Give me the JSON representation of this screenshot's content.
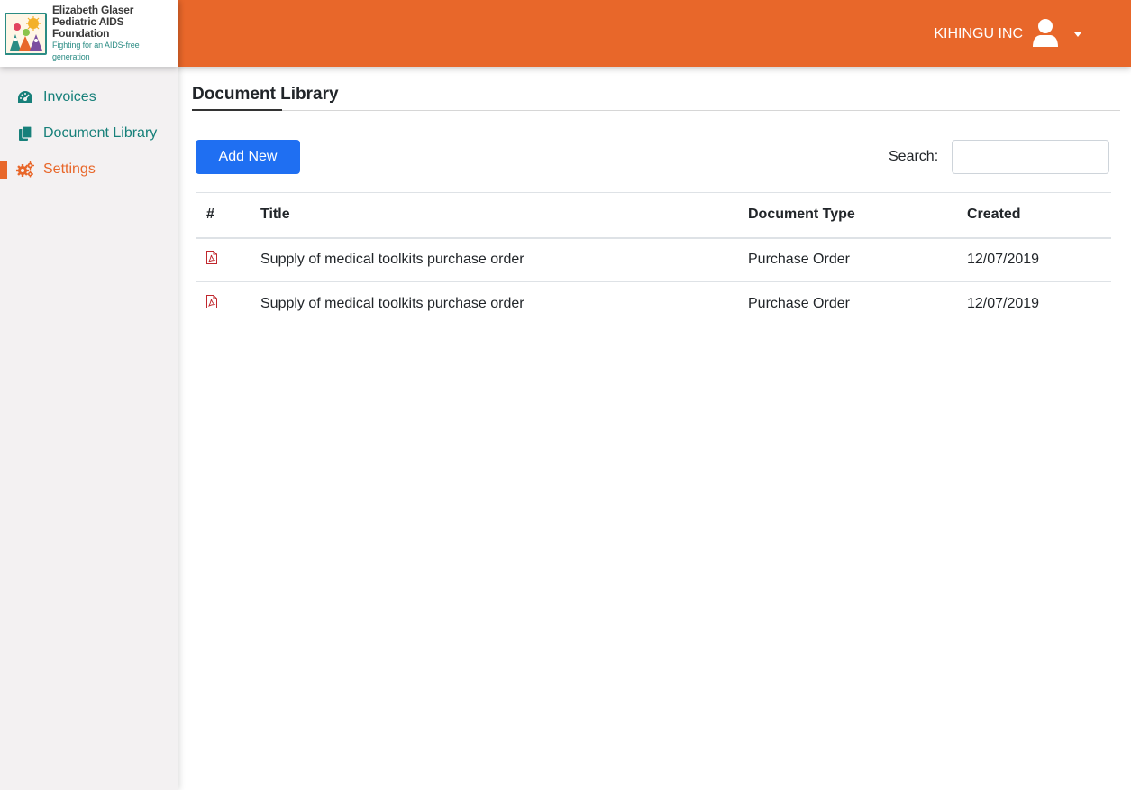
{
  "logo": {
    "line1": "Elizabeth Glaser",
    "line2": "Pediatric AIDS Foundation",
    "line3": "Fighting for an AIDS-free generation"
  },
  "sidebar": {
    "items": [
      {
        "label": "Invoices",
        "icon": "dashboard-icon",
        "active": false
      },
      {
        "label": "Document Library",
        "icon": "documents-icon",
        "active": false
      },
      {
        "label": "Settings",
        "icon": "cogs-icon",
        "active": true
      }
    ]
  },
  "header": {
    "user_name": "KIHINGU INC",
    "user_icon": "user-icon",
    "dropdown_icon": "caret-down-icon"
  },
  "page": {
    "title": "Document Library",
    "add_button": "Add New",
    "search_label": "Search:",
    "search_value": ""
  },
  "table": {
    "columns": [
      "#",
      "Title",
      "Document Type",
      "Created"
    ],
    "rows": [
      {
        "icon": "pdf-file-icon",
        "title": "Supply of medical toolkits purchase order",
        "type": "Purchase Order",
        "created": "12/07/2019"
      },
      {
        "icon": "pdf-file-icon",
        "title": "Supply of medical toolkits purchase order",
        "type": "Purchase Order",
        "created": "12/07/2019"
      }
    ]
  },
  "colors": {
    "brand_orange": "#e8672a",
    "nav_teal": "#17807a",
    "primary_blue": "#1f6ff2",
    "pdf_red": "#c0272d"
  }
}
